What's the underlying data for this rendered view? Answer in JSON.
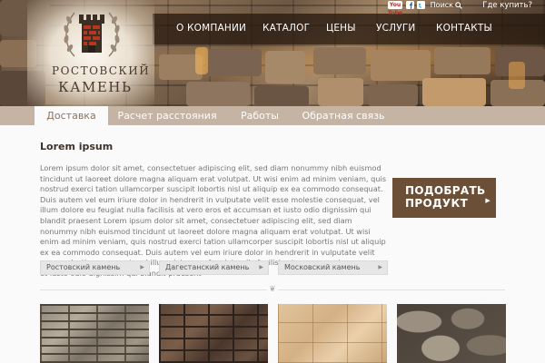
{
  "logo": {
    "line1": "РОСТОВСКИЙ",
    "line2": "КАМЕНЬ"
  },
  "top_links": {
    "youtube_label": "You Tube",
    "search_label": "Поиск",
    "where_to_buy": "Где купить?"
  },
  "nav": {
    "items": [
      "О КОМПАНИИ",
      "КАТАЛОГ",
      "ЦЕНЫ",
      "УСЛУГИ",
      "КОНТАКТЫ"
    ]
  },
  "tabs": [
    "Доставка",
    "Расчет расстояния",
    "Работы",
    "Обратная связь"
  ],
  "main": {
    "title": "Lorem ipsum",
    "paragraph": "Lorem ipsum dolor sit amet, consectetuer adipiscing elit, sed diam nonummy nibh euismod tincidunt ut laoreet dolore magna aliquam erat volutpat. Ut wisi enim ad minim veniam, quis nostrud exerci tation ullamcorper suscipit lobortis nisl ut aliquip ex ea commodo consequat. Duis autem vel eum iriure dolor in hendrerit in vulputate velit esse molestie consequat, vel illum dolore eu feugiat nulla facilisis at vero eros et accumsan et iusto odio dignissim qui blandit praesent Lorem ipsum dolor sit amet, consectetuer adipiscing elit, sed diam nonummy nibh euismod tincidunt ut laoreet dolore magna aliquam erat volutpat. Ut wisi enim ad minim veniam, quis nostrud exerci tation ullamcorper suscipit lobortis nisl ut aliquip ex ea commodo consequat. Duis autem vel eum iriure dolor in hendrerit in vulputate velit esse molestie consequat, vel illum dolore eu feugiat nulla facilisis at vero eros et accumsan et iusto odio dignissim qui blandit praesent"
  },
  "select_product": {
    "line1": "ПОДОБРАТЬ",
    "line2": "ПРОДУКТ"
  },
  "categories": [
    "Ростовский камень",
    "Дагестанский камень",
    "Московский камень"
  ],
  "colors": {
    "accent_brown": "#6b4f36",
    "tab_bar": "#c5b3a3",
    "nav_bar": "#281a10"
  }
}
